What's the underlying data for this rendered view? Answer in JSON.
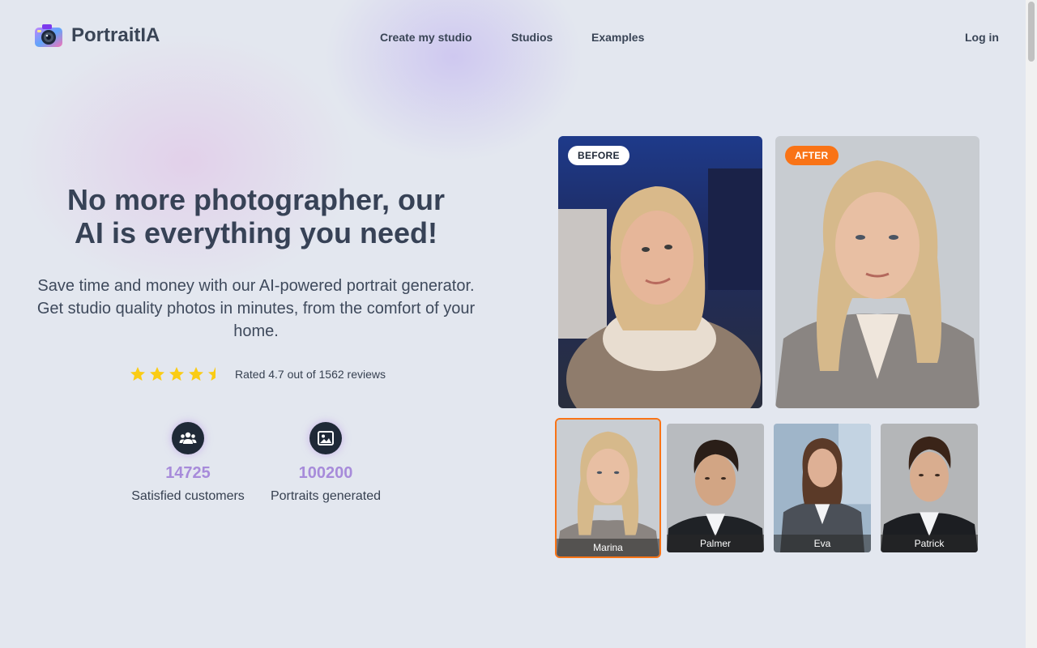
{
  "brand": {
    "name": "PortraitIA",
    "accent": "#f97316",
    "stat_color": "#a78bda"
  },
  "nav": {
    "create": "Create my studio",
    "studios": "Studios",
    "examples": "Examples",
    "login": "Log in"
  },
  "hero": {
    "title_line1": "No more photographer, our",
    "title_line2": "AI is everything you need!",
    "subtitle": "Save time and money with our AI-powered portrait generator. Get studio quality photos in minutes, from the comfort of your home."
  },
  "rating": {
    "stars": 4.7,
    "max_stars": 5,
    "text": "Rated 4.7 out of 1562 reviews"
  },
  "stats": [
    {
      "icon": "users-icon",
      "value": "14725",
      "label": "Satisfied customers"
    },
    {
      "icon": "image-icon",
      "value": "100200",
      "label": "Portraits generated"
    }
  ],
  "comparison": {
    "before_label": "BEFORE",
    "after_label": "AFTER"
  },
  "people": [
    {
      "name": "Marina",
      "selected": true
    },
    {
      "name": "Palmer",
      "selected": false
    },
    {
      "name": "Eva",
      "selected": false
    },
    {
      "name": "Patrick",
      "selected": false
    }
  ]
}
